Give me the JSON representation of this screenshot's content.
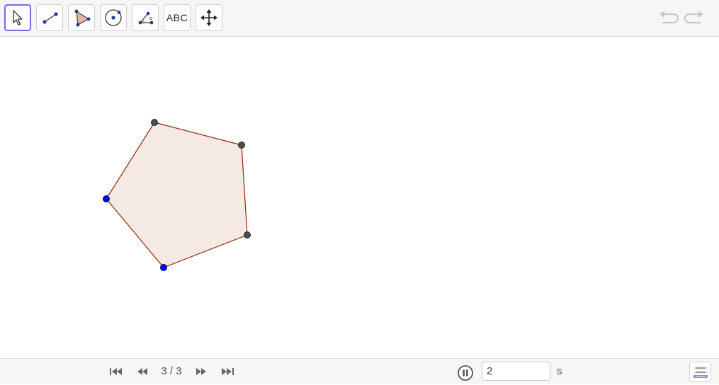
{
  "toolbar": {
    "tools": [
      {
        "name": "move-tool",
        "icon": "arrow-cursor-icon"
      },
      {
        "name": "segment-tool",
        "icon": "segment-icon"
      },
      {
        "name": "polygon-tool",
        "icon": "polygon-icon"
      },
      {
        "name": "circle-tool",
        "icon": "circle-center-point-icon"
      },
      {
        "name": "angle-tool",
        "icon": "angle-icon"
      },
      {
        "name": "text-tool",
        "label": "ABC"
      },
      {
        "name": "move-graphics-view-tool",
        "icon": "move-arrows-icon"
      }
    ],
    "selected_tool": "move-tool"
  },
  "colors": {
    "selected_border": "#6e6ee0",
    "polygon_fill": "#f5e9e4",
    "polygon_stroke": "#8b2b0e",
    "free_point": "#0000ff",
    "dependent_point": "#4d4d4d"
  },
  "bottombar": {
    "page_counter": "3 / 3",
    "speed_value": "2",
    "speed_unit": "s"
  }
}
